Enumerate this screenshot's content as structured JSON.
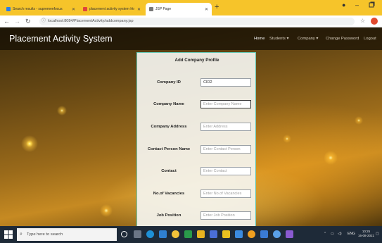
{
  "browser": {
    "tabs": [
      {
        "title": "Search results - supremenfocus",
        "favicon_color": "#2b7de9"
      },
      {
        "title": "placement activity system html",
        "favicon_color": "#e0443a"
      },
      {
        "title": "JSP Page",
        "favicon_color": "#777777"
      }
    ],
    "new_tab": "+",
    "window_controls": {
      "minimize": "–",
      "maximize": "▢"
    },
    "address": "localhost:8084/PlacementActivity/addcompany.jsp"
  },
  "navbar": {
    "brand": "Placement Activity System",
    "items": [
      {
        "label": "Home"
      },
      {
        "label": "Students ▾"
      },
      {
        "label": "Company ▾"
      },
      {
        "label": "Change Password"
      },
      {
        "label": "Logout"
      }
    ]
  },
  "form": {
    "title": "Add Company Profile",
    "fields": [
      {
        "label": "Company ID",
        "value": "CID2",
        "placeholder": ""
      },
      {
        "label": "Company Name",
        "value": "",
        "placeholder": "Enter Company Name"
      },
      {
        "label": "Company Address",
        "value": "",
        "placeholder": "Enter Address"
      },
      {
        "label": "Contact Person Name",
        "value": "",
        "placeholder": "Enter Contact Person"
      },
      {
        "label": "Contact",
        "value": "",
        "placeholder": "Enter Contact"
      },
      {
        "label": "No.of Vacancies",
        "value": "",
        "placeholder": "Enter No.of Vacancies"
      },
      {
        "label": "Job Position",
        "value": "",
        "placeholder": "Enter Job Position"
      }
    ]
  },
  "taskbar": {
    "search_placeholder": "Type here to search",
    "language": "ENG",
    "time": "10:25",
    "date": "16-08-2021"
  },
  "colors": {
    "tab_bar": "#f6c42a",
    "panel_border": "#61c7b2",
    "taskbar": "#1e2a38"
  }
}
